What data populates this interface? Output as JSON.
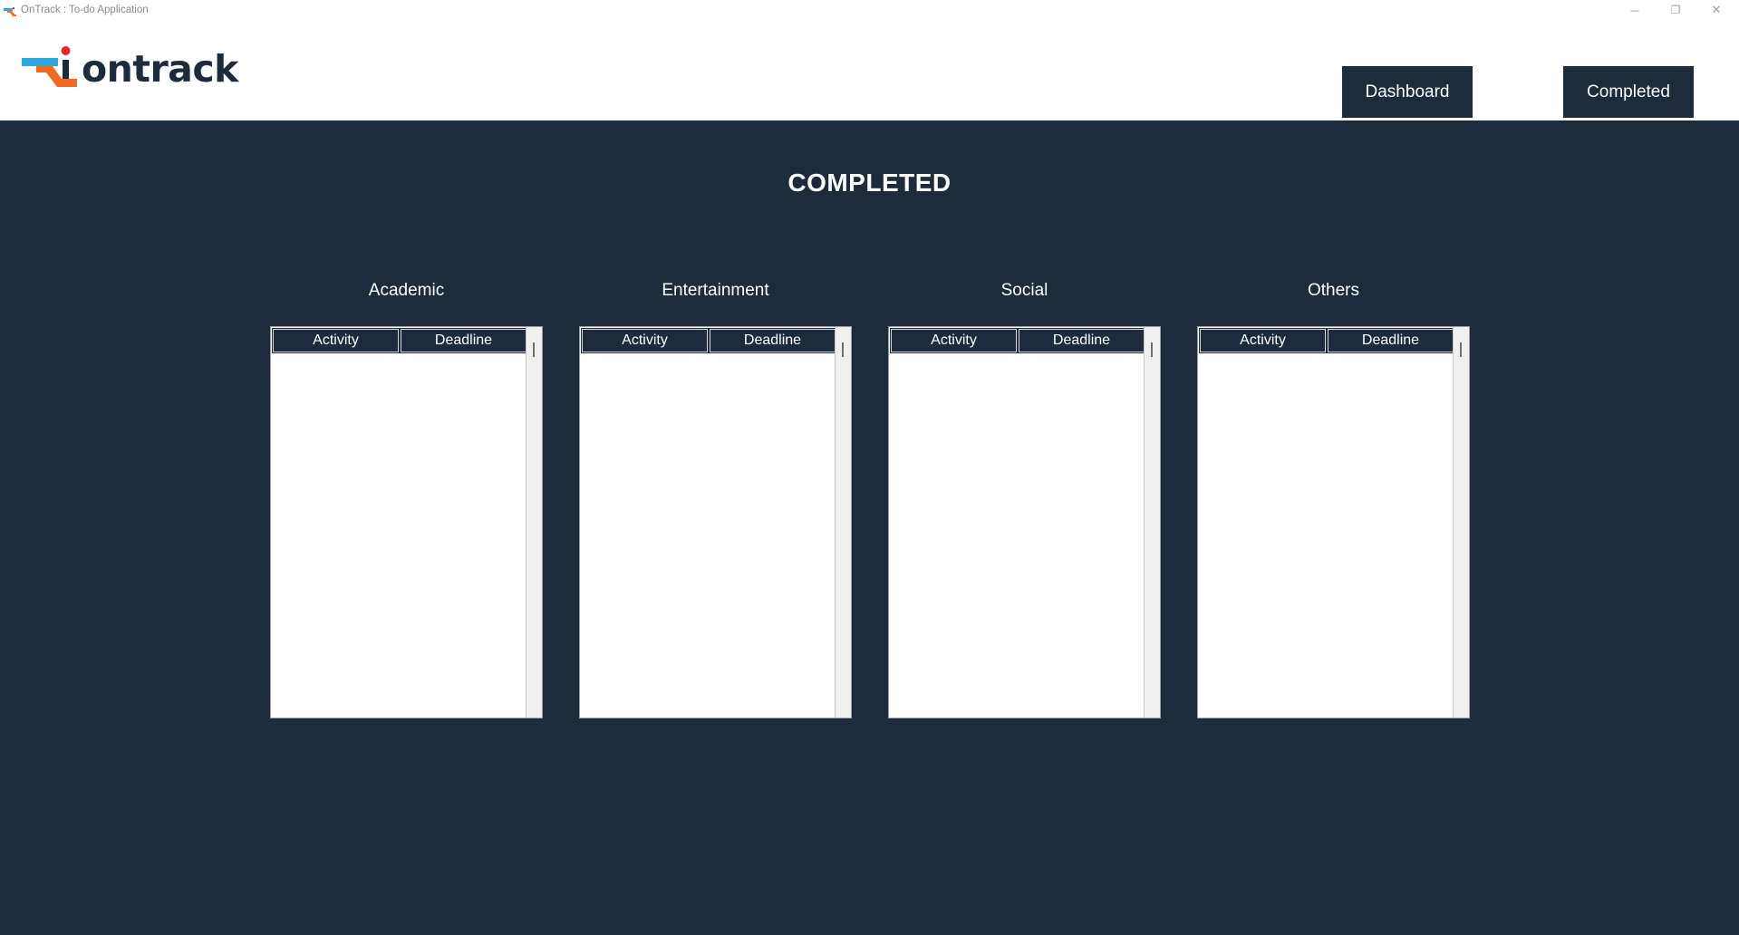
{
  "window": {
    "title": "OnTrack : To-do Application",
    "controls": {
      "minimize": "─",
      "maximize": "❐",
      "close": "✕"
    }
  },
  "header": {
    "logo_text": "ontrack",
    "nav": {
      "dashboard_label": "Dashboard",
      "completed_label": "Completed"
    }
  },
  "main": {
    "page_title": "COMPLETED",
    "panels": [
      {
        "label": "Academic",
        "columns": [
          "Activity",
          "Deadline"
        ],
        "rows": []
      },
      {
        "label": "Entertainment",
        "columns": [
          "Activity",
          "Deadline"
        ],
        "rows": []
      },
      {
        "label": "Social",
        "columns": [
          "Activity",
          "Deadline"
        ],
        "rows": []
      },
      {
        "label": "Others",
        "columns": [
          "Activity",
          "Deadline"
        ],
        "rows": []
      }
    ]
  },
  "colors": {
    "background": "#1e2b3c",
    "accent_blue": "#2fa8e0",
    "accent_orange": "#f26a21",
    "logo_red_dot": "#e2262a",
    "header_bg": "#ffffff"
  }
}
